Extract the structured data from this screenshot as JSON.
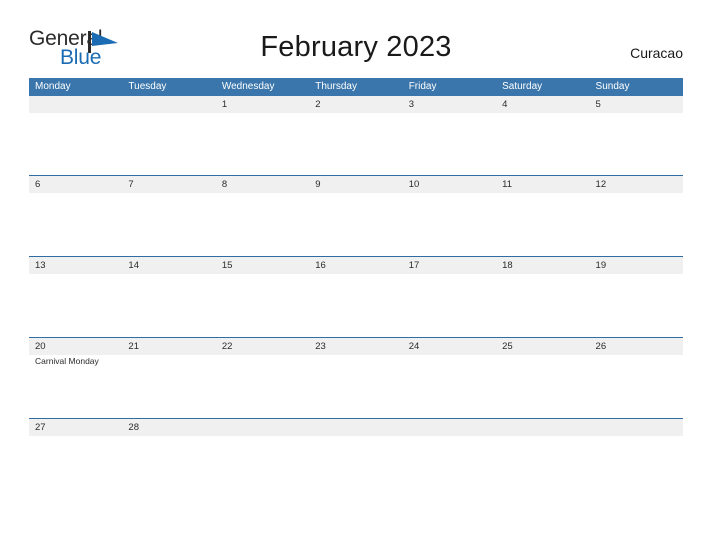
{
  "brand": {
    "word_one": "General",
    "word_two": "Blue",
    "flag_icon": "blue-flag-triangle-icon",
    "flag_color": "#1b6cb3",
    "word_one_color": "#2b2b2b",
    "word_two_color": "#1b6cb3"
  },
  "header": {
    "title": "February 2023",
    "location": "Curacao"
  },
  "calendar": {
    "accent_color": "#3a76ab",
    "rule_color": "#2f6da3",
    "band_color": "#f0f0f0",
    "weekdays": [
      "Monday",
      "Tuesday",
      "Wednesday",
      "Thursday",
      "Friday",
      "Saturday",
      "Sunday"
    ],
    "weeks": [
      {
        "days": [
          {
            "date": "",
            "events": []
          },
          {
            "date": "",
            "events": []
          },
          {
            "date": "1",
            "events": []
          },
          {
            "date": "2",
            "events": []
          },
          {
            "date": "3",
            "events": []
          },
          {
            "date": "4",
            "events": []
          },
          {
            "date": "5",
            "events": []
          }
        ]
      },
      {
        "days": [
          {
            "date": "6",
            "events": []
          },
          {
            "date": "7",
            "events": []
          },
          {
            "date": "8",
            "events": []
          },
          {
            "date": "9",
            "events": []
          },
          {
            "date": "10",
            "events": []
          },
          {
            "date": "11",
            "events": []
          },
          {
            "date": "12",
            "events": []
          }
        ]
      },
      {
        "days": [
          {
            "date": "13",
            "events": []
          },
          {
            "date": "14",
            "events": []
          },
          {
            "date": "15",
            "events": []
          },
          {
            "date": "16",
            "events": []
          },
          {
            "date": "17",
            "events": []
          },
          {
            "date": "18",
            "events": []
          },
          {
            "date": "19",
            "events": []
          }
        ]
      },
      {
        "days": [
          {
            "date": "20",
            "events": [
              "Carnival Monday"
            ]
          },
          {
            "date": "21",
            "events": []
          },
          {
            "date": "22",
            "events": []
          },
          {
            "date": "23",
            "events": []
          },
          {
            "date": "24",
            "events": []
          },
          {
            "date": "25",
            "events": []
          },
          {
            "date": "26",
            "events": []
          }
        ]
      },
      {
        "days": [
          {
            "date": "27",
            "events": []
          },
          {
            "date": "28",
            "events": []
          },
          {
            "date": "",
            "events": []
          },
          {
            "date": "",
            "events": []
          },
          {
            "date": "",
            "events": []
          },
          {
            "date": "",
            "events": []
          },
          {
            "date": "",
            "events": []
          }
        ]
      }
    ]
  }
}
